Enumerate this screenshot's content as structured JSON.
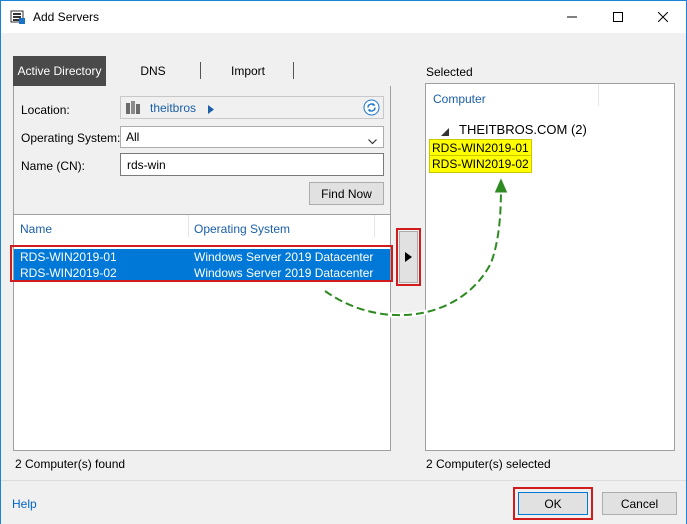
{
  "window": {
    "title": "Add Servers",
    "accent": "#0078d7"
  },
  "tabs": [
    {
      "label": "Active Directory",
      "active": true
    },
    {
      "label": "DNS",
      "active": false
    },
    {
      "label": "Import",
      "active": false
    }
  ],
  "query": {
    "location_label": "Location:",
    "location_value": "theitbros",
    "os_label": "Operating System:",
    "os_value": "All",
    "name_label": "Name (CN):",
    "name_value": "rds-win",
    "find_button": "Find Now"
  },
  "results": {
    "columns": [
      "Name",
      "Operating System"
    ],
    "rows": [
      {
        "name": "RDS-WIN2019-01",
        "os": "Windows Server 2019 Datacenter"
      },
      {
        "name": "RDS-WIN2019-02",
        "os": "Windows Server 2019 Datacenter"
      }
    ],
    "status": "2 Computer(s) found"
  },
  "selected": {
    "label": "Selected",
    "column": "Computer",
    "group": "THEITBROS.COM (2)",
    "items": [
      "RDS-WIN2019-01",
      "RDS-WIN2019-02"
    ],
    "status": "2 Computer(s) selected"
  },
  "footer": {
    "help": "Help",
    "ok": "OK",
    "cancel": "Cancel"
  },
  "icons": [
    "server-manager-icon",
    "minimize-icon",
    "maximize-icon",
    "close-icon",
    "domain-icon",
    "chevron-right-icon",
    "refresh-icon",
    "chevron-down-icon",
    "add-arrow-icon",
    "expand-triangle-icon"
  ]
}
